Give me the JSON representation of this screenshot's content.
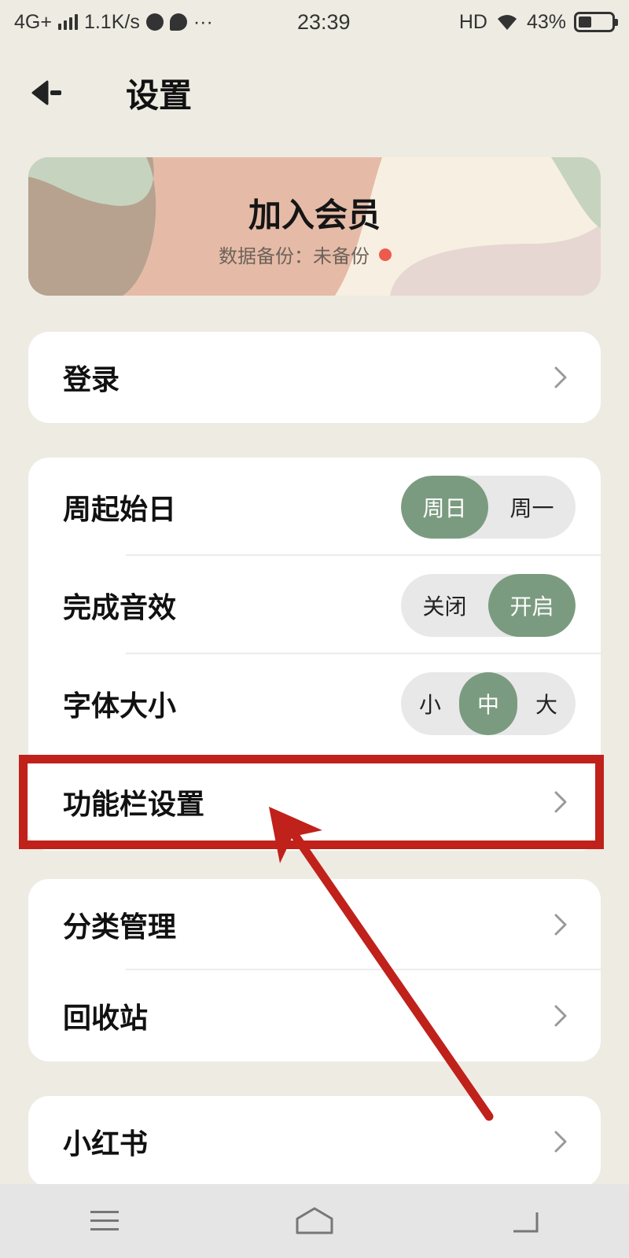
{
  "status_bar": {
    "network": "4G+",
    "speed": "1.1K/s",
    "more": "···",
    "time": "23:39",
    "hd": "HD",
    "battery_percent": "43%",
    "battery_level": 0.43
  },
  "header": {
    "title": "设置"
  },
  "banner": {
    "title": "加入会员",
    "backup_label": "数据备份：",
    "backup_status": "未备份",
    "status_dot_color": "#ee5b4b"
  },
  "login": {
    "label": "登录"
  },
  "settings": {
    "week_start": {
      "label": "周起始日",
      "options": [
        "周日",
        "周一"
      ],
      "selected": "周日"
    },
    "sound": {
      "label": "完成音效",
      "options": [
        "关闭",
        "开启"
      ],
      "selected": "开启"
    },
    "font_size": {
      "label": "字体大小",
      "options": [
        "小",
        "中",
        "大"
      ],
      "selected": "中"
    },
    "toolbar": {
      "label": "功能栏设置"
    }
  },
  "manage": {
    "category": "分类管理",
    "recycle": "回收站"
  },
  "social": {
    "xiaohongshu": "小红书"
  },
  "colors": {
    "accent": "#7b9b80",
    "annotation": "#c0211b",
    "background": "#eeebe3"
  }
}
